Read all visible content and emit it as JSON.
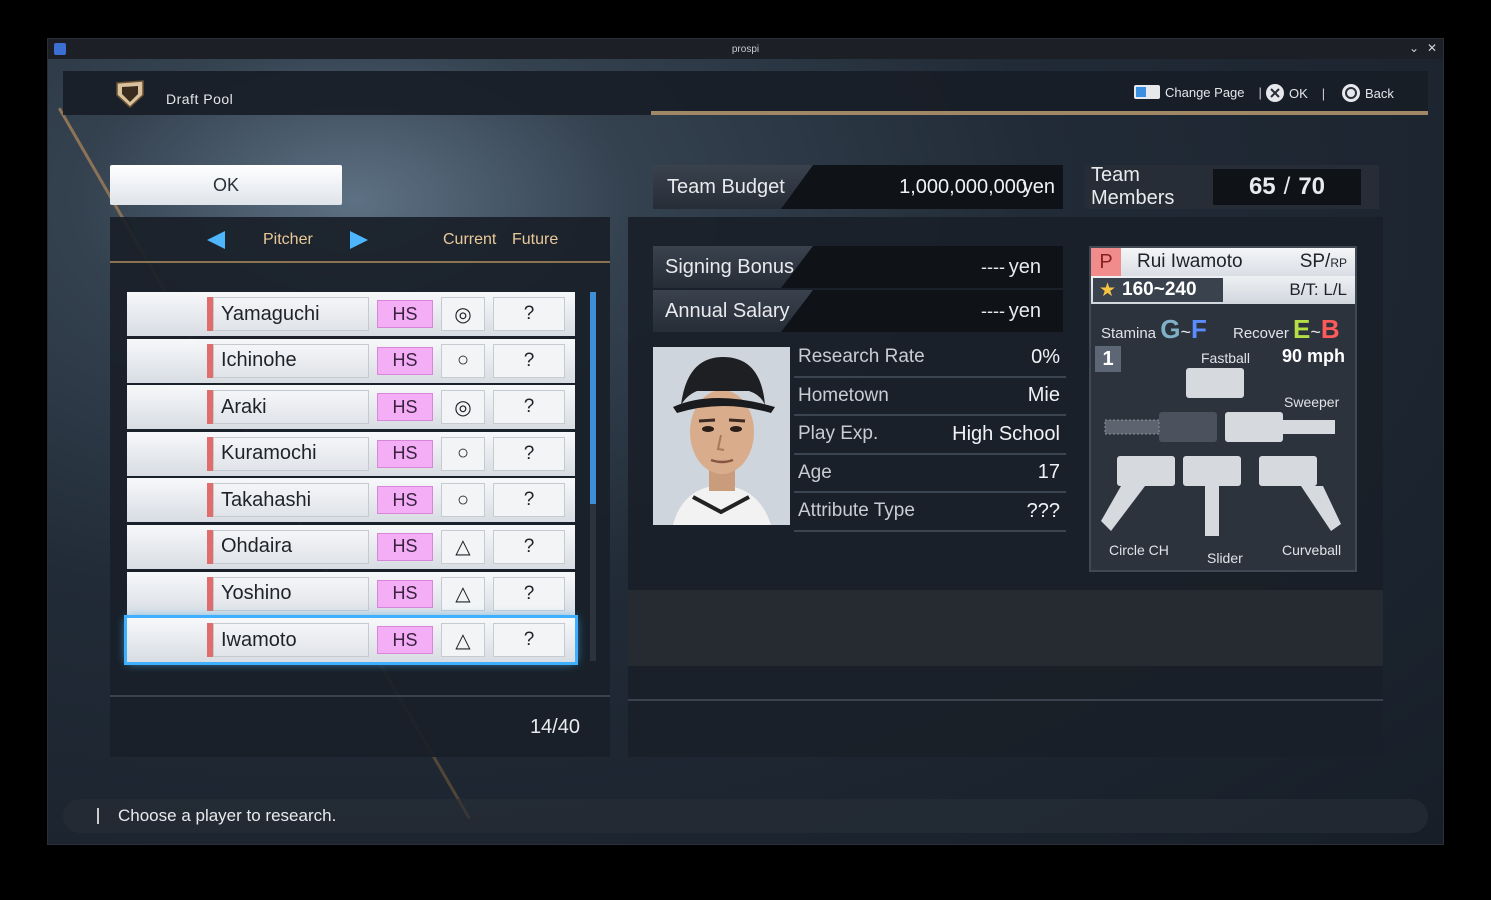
{
  "window": {
    "title": "prospi"
  },
  "header": {
    "title": "Draft Pool",
    "hints": [
      {
        "icon": "change-page-icon",
        "label": "Change Page"
      },
      {
        "icon": "cross-button-icon",
        "label": "OK"
      },
      {
        "icon": "circle-button-icon",
        "label": "Back"
      }
    ]
  },
  "ok_button": "OK",
  "list": {
    "category": "Pitcher",
    "col_current": "Current",
    "col_future": "Future",
    "count": "14/40",
    "players": [
      {
        "name": "Yamaguchi",
        "tag": "HS",
        "current": "◎",
        "future": "?"
      },
      {
        "name": "Ichinohe",
        "tag": "HS",
        "current": "○",
        "future": "?"
      },
      {
        "name": "Araki",
        "tag": "HS",
        "current": "◎",
        "future": "?"
      },
      {
        "name": "Kuramochi",
        "tag": "HS",
        "current": "○",
        "future": "?"
      },
      {
        "name": "Takahashi",
        "tag": "HS",
        "current": "○",
        "future": "?"
      },
      {
        "name": "Ohdaira",
        "tag": "HS",
        "current": "△",
        "future": "?"
      },
      {
        "name": "Yoshino",
        "tag": "HS",
        "current": "△",
        "future": "?"
      },
      {
        "name": "Iwamoto",
        "tag": "HS",
        "current": "△",
        "future": "?"
      }
    ],
    "selected_index": 7
  },
  "team": {
    "budget_label": "Team Budget",
    "budget_value": "1,000,000,000",
    "budget_unit": "yen",
    "members_label": "Team Members",
    "members_current": "65",
    "members_sep": "/",
    "members_max": "70"
  },
  "contract": {
    "signing_label": "Signing Bonus",
    "signing_value": "----",
    "signing_unit": "yen",
    "salary_label": "Annual Salary",
    "salary_value": "----",
    "salary_unit": "yen"
  },
  "info": [
    {
      "key": "Research Rate",
      "value": "0%"
    },
    {
      "key": "Hometown",
      "value": "Mie"
    },
    {
      "key": "Play Exp.",
      "value": "High School"
    },
    {
      "key": "Age",
      "value": "17"
    },
    {
      "key": "Attribute Type",
      "value": "???"
    }
  ],
  "card": {
    "position": "P",
    "name": "Rui Iwamoto",
    "role_main": "SP/",
    "role_sub": "RP",
    "star": "★",
    "overall": "160~240",
    "bt": "B/T: L/L",
    "stamina_label": "Stamina",
    "stamina_low": "G",
    "stamina_high": "F",
    "recover_label": "Recover",
    "recover_low": "E",
    "recover_high": "B",
    "tilde": "~",
    "pitch_number": "1",
    "fastball_label": "Fastball",
    "velocity": "90",
    "velocity_unit": "mph",
    "pitches": {
      "sweeper": "Sweeper",
      "circle_ch": "Circle CH",
      "slider": "Slider",
      "curveball": "Curveball"
    }
  },
  "footer": {
    "message": "Choose a player to research."
  },
  "colors": {
    "accent": "#3fb0ff",
    "tag_bg": "#f4aef5",
    "gold": "#a08866",
    "label_gold": "#e9c99a"
  }
}
